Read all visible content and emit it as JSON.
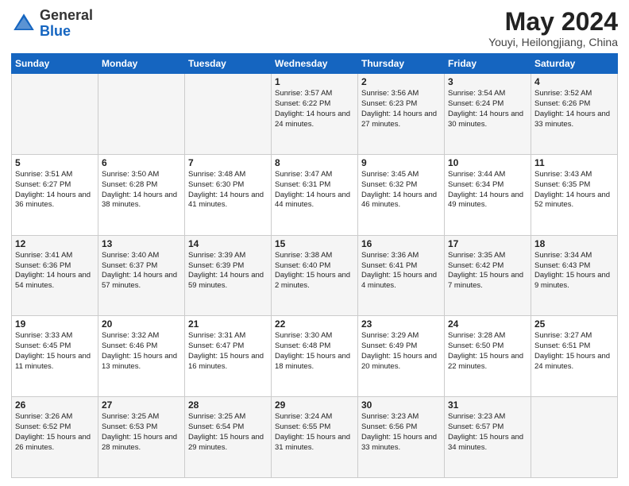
{
  "header": {
    "logo_general": "General",
    "logo_blue": "Blue",
    "month_title": "May 2024",
    "location": "Youyi, Heilongjiang, China"
  },
  "weekdays": [
    "Sunday",
    "Monday",
    "Tuesday",
    "Wednesday",
    "Thursday",
    "Friday",
    "Saturday"
  ],
  "rows": [
    [
      {
        "day": "",
        "info": ""
      },
      {
        "day": "",
        "info": ""
      },
      {
        "day": "",
        "info": ""
      },
      {
        "day": "1",
        "info": "Sunrise: 3:57 AM\nSunset: 6:22 PM\nDaylight: 14 hours and 24 minutes."
      },
      {
        "day": "2",
        "info": "Sunrise: 3:56 AM\nSunset: 6:23 PM\nDaylight: 14 hours and 27 minutes."
      },
      {
        "day": "3",
        "info": "Sunrise: 3:54 AM\nSunset: 6:24 PM\nDaylight: 14 hours and 30 minutes."
      },
      {
        "day": "4",
        "info": "Sunrise: 3:52 AM\nSunset: 6:26 PM\nDaylight: 14 hours and 33 minutes."
      }
    ],
    [
      {
        "day": "5",
        "info": "Sunrise: 3:51 AM\nSunset: 6:27 PM\nDaylight: 14 hours and 36 minutes."
      },
      {
        "day": "6",
        "info": "Sunrise: 3:50 AM\nSunset: 6:28 PM\nDaylight: 14 hours and 38 minutes."
      },
      {
        "day": "7",
        "info": "Sunrise: 3:48 AM\nSunset: 6:30 PM\nDaylight: 14 hours and 41 minutes."
      },
      {
        "day": "8",
        "info": "Sunrise: 3:47 AM\nSunset: 6:31 PM\nDaylight: 14 hours and 44 minutes."
      },
      {
        "day": "9",
        "info": "Sunrise: 3:45 AM\nSunset: 6:32 PM\nDaylight: 14 hours and 46 minutes."
      },
      {
        "day": "10",
        "info": "Sunrise: 3:44 AM\nSunset: 6:34 PM\nDaylight: 14 hours and 49 minutes."
      },
      {
        "day": "11",
        "info": "Sunrise: 3:43 AM\nSunset: 6:35 PM\nDaylight: 14 hours and 52 minutes."
      }
    ],
    [
      {
        "day": "12",
        "info": "Sunrise: 3:41 AM\nSunset: 6:36 PM\nDaylight: 14 hours and 54 minutes."
      },
      {
        "day": "13",
        "info": "Sunrise: 3:40 AM\nSunset: 6:37 PM\nDaylight: 14 hours and 57 minutes."
      },
      {
        "day": "14",
        "info": "Sunrise: 3:39 AM\nSunset: 6:39 PM\nDaylight: 14 hours and 59 minutes."
      },
      {
        "day": "15",
        "info": "Sunrise: 3:38 AM\nSunset: 6:40 PM\nDaylight: 15 hours and 2 minutes."
      },
      {
        "day": "16",
        "info": "Sunrise: 3:36 AM\nSunset: 6:41 PM\nDaylight: 15 hours and 4 minutes."
      },
      {
        "day": "17",
        "info": "Sunrise: 3:35 AM\nSunset: 6:42 PM\nDaylight: 15 hours and 7 minutes."
      },
      {
        "day": "18",
        "info": "Sunrise: 3:34 AM\nSunset: 6:43 PM\nDaylight: 15 hours and 9 minutes."
      }
    ],
    [
      {
        "day": "19",
        "info": "Sunrise: 3:33 AM\nSunset: 6:45 PM\nDaylight: 15 hours and 11 minutes."
      },
      {
        "day": "20",
        "info": "Sunrise: 3:32 AM\nSunset: 6:46 PM\nDaylight: 15 hours and 13 minutes."
      },
      {
        "day": "21",
        "info": "Sunrise: 3:31 AM\nSunset: 6:47 PM\nDaylight: 15 hours and 16 minutes."
      },
      {
        "day": "22",
        "info": "Sunrise: 3:30 AM\nSunset: 6:48 PM\nDaylight: 15 hours and 18 minutes."
      },
      {
        "day": "23",
        "info": "Sunrise: 3:29 AM\nSunset: 6:49 PM\nDaylight: 15 hours and 20 minutes."
      },
      {
        "day": "24",
        "info": "Sunrise: 3:28 AM\nSunset: 6:50 PM\nDaylight: 15 hours and 22 minutes."
      },
      {
        "day": "25",
        "info": "Sunrise: 3:27 AM\nSunset: 6:51 PM\nDaylight: 15 hours and 24 minutes."
      }
    ],
    [
      {
        "day": "26",
        "info": "Sunrise: 3:26 AM\nSunset: 6:52 PM\nDaylight: 15 hours and 26 minutes."
      },
      {
        "day": "27",
        "info": "Sunrise: 3:25 AM\nSunset: 6:53 PM\nDaylight: 15 hours and 28 minutes."
      },
      {
        "day": "28",
        "info": "Sunrise: 3:25 AM\nSunset: 6:54 PM\nDaylight: 15 hours and 29 minutes."
      },
      {
        "day": "29",
        "info": "Sunrise: 3:24 AM\nSunset: 6:55 PM\nDaylight: 15 hours and 31 minutes."
      },
      {
        "day": "30",
        "info": "Sunrise: 3:23 AM\nSunset: 6:56 PM\nDaylight: 15 hours and 33 minutes."
      },
      {
        "day": "31",
        "info": "Sunrise: 3:23 AM\nSunset: 6:57 PM\nDaylight: 15 hours and 34 minutes."
      },
      {
        "day": "",
        "info": ""
      }
    ]
  ]
}
